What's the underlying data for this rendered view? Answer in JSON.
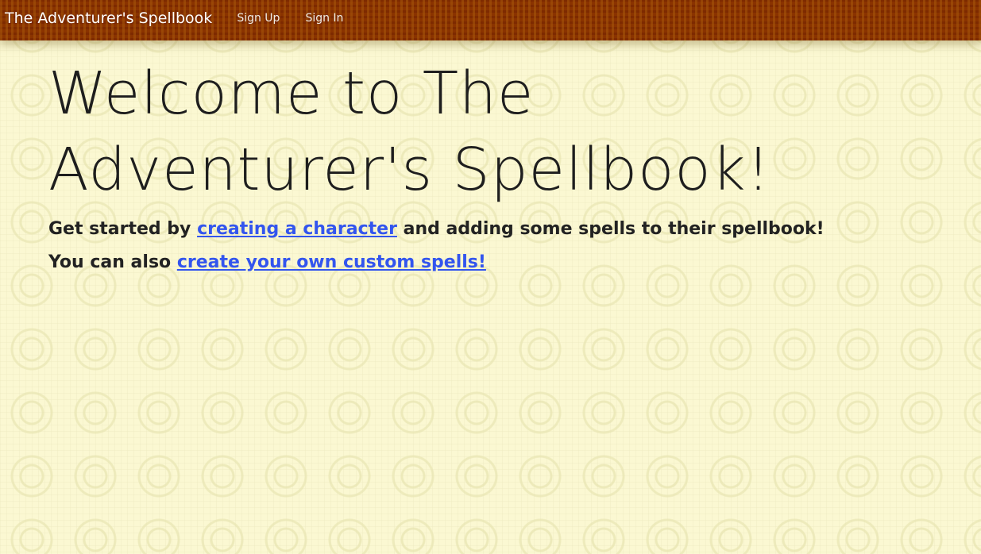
{
  "nav": {
    "brand": "The Adventurer's Spellbook",
    "sign_up": "Sign Up",
    "sign_in": "Sign In"
  },
  "hero": {
    "title": "Welcome to The Adventurer's Spellbook!",
    "line1_before": "Get started by ",
    "line1_link": "creating a character",
    "line1_after": " and adding some spells to their spellbook!",
    "line2_before": "You can also ",
    "line2_link": "create your own custom spells!"
  },
  "colors": {
    "nav_background": "#8a3300",
    "page_background": "#fbf8d2",
    "link": "#3355ee"
  }
}
